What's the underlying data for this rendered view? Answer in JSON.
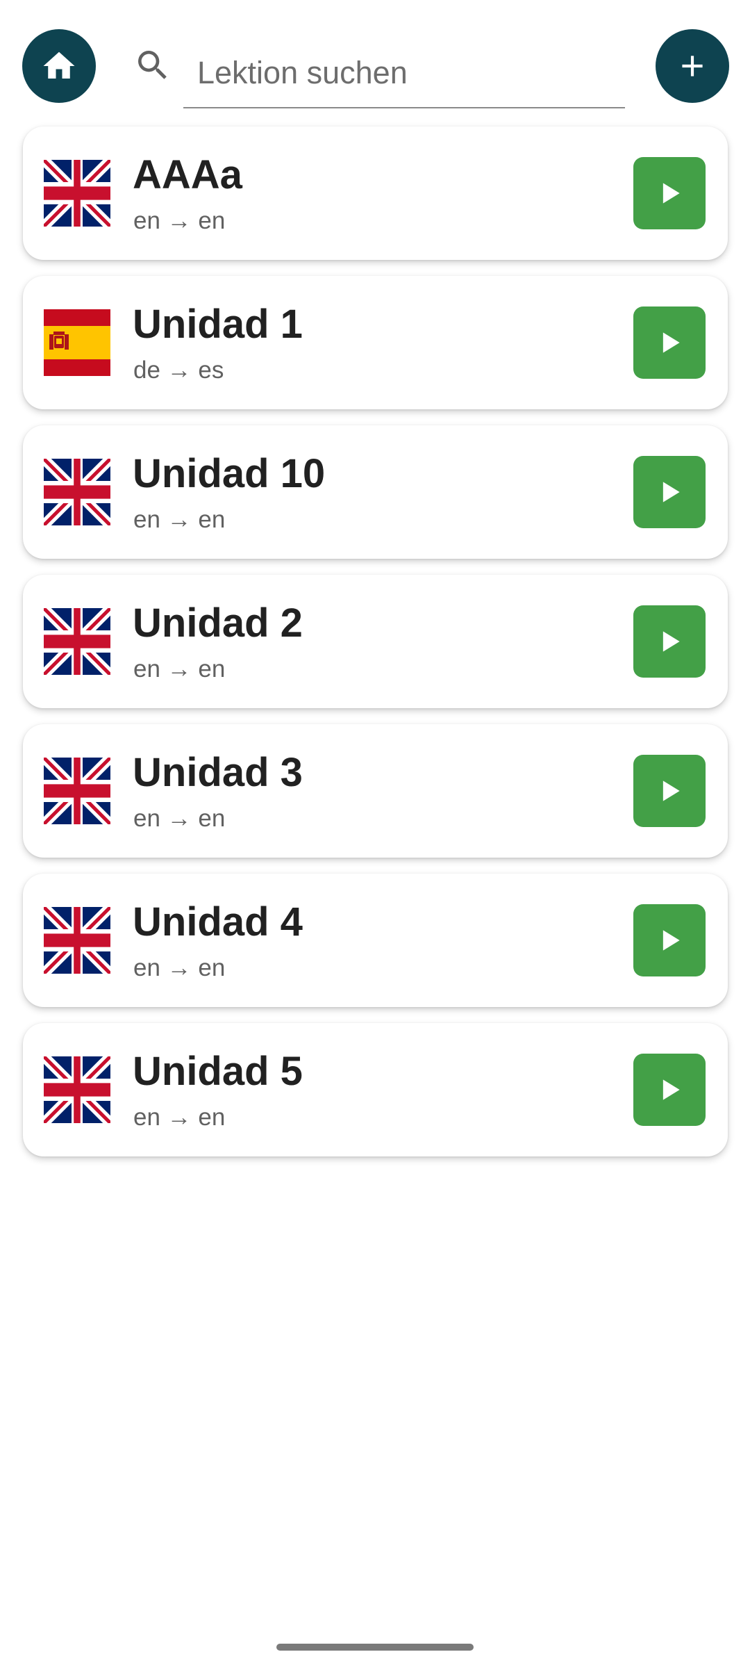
{
  "header": {
    "home_icon": "home-icon",
    "search_icon": "search-icon",
    "search_placeholder": "Lektion suchen",
    "search_value": "",
    "add_icon": "plus-icon",
    "accent_color": "#0e4350"
  },
  "lessons": [
    {
      "title": "AAAa",
      "pair": "en → en",
      "flag": "uk"
    },
    {
      "title": "Unidad 1",
      "pair": "de → es",
      "flag": "es"
    },
    {
      "title": "Unidad 10",
      "pair": "en → en",
      "flag": "uk"
    },
    {
      "title": "Unidad 2",
      "pair": "en → en",
      "flag": "uk"
    },
    {
      "title": "Unidad 3",
      "pair": "en → en",
      "flag": "uk"
    },
    {
      "title": "Unidad 4",
      "pair": "en → en",
      "flag": "uk"
    },
    {
      "title": "Unidad 5",
      "pair": "en → en",
      "flag": "uk"
    }
  ],
  "play_icon": "play-icon",
  "play_color": "#43a047"
}
